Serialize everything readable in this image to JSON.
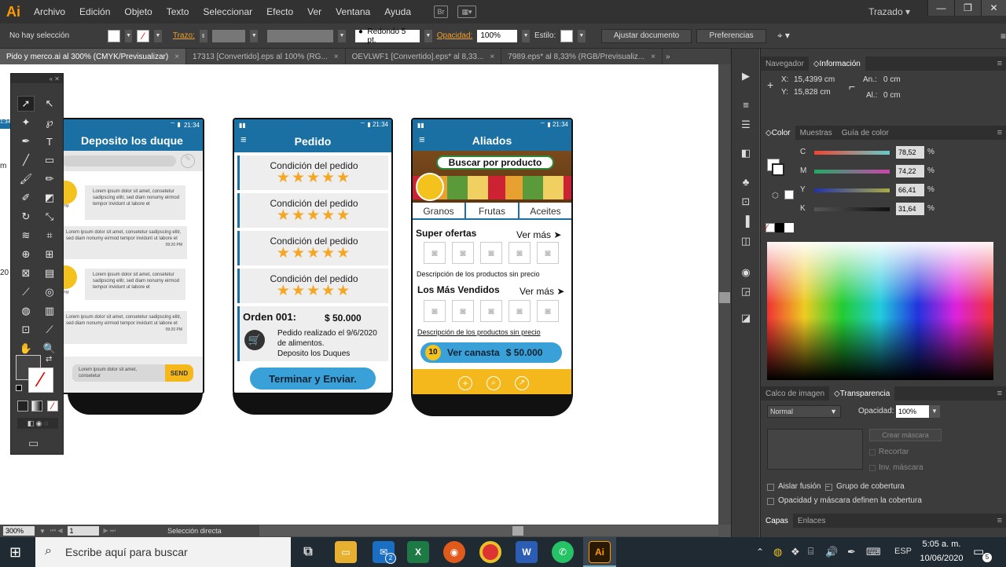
{
  "app": {
    "logo": "Ai",
    "menu": [
      "Archivo",
      "Edición",
      "Objeto",
      "Texto",
      "Seleccionar",
      "Efecto",
      "Ver",
      "Ventana",
      "Ayuda"
    ],
    "bridge_icon": "Br",
    "workspace": "Trazado",
    "window_controls": [
      "—",
      "❐",
      "✕"
    ]
  },
  "controlbar": {
    "selection": "No hay selección",
    "stroke_label": "Trazo:",
    "brush": "Redondo 5 pt.",
    "opacity_label": "Opacidad:",
    "opacity_value": "100%",
    "style_label": "Estilo:",
    "doc_setup_button": "Ajustar documento",
    "prefs_button": "Preferencias"
  },
  "tabs": [
    {
      "label": "Pido y merco.ai al 300% (CMYK/Previsualizar)",
      "active": true
    },
    {
      "label": "17313 [Convertido].eps al 100% (RG...",
      "active": false
    },
    {
      "label": "OEVLWF1 [Convertido].eps* al 8,33...",
      "active": false
    },
    {
      "label": "7989.eps* al 8,33% (RGB/Previsualiz...",
      "active": false
    }
  ],
  "statusbar": {
    "zoom": "300%",
    "artboard": "1",
    "tool_name": "Selección directa"
  },
  "mockups": {
    "chat": {
      "time": "21:34",
      "time_partial": "1:34",
      "title": "Deposito los duque",
      "lorem_short": "Lorem ipsum dolor sit amet, consetetur sadipscing elitr, sed diam nonumy eirmod tempor invidunt ut labore et",
      "lorem_long": "Lorem ipsum dolor sit amet, consetetur sadipscing elitr, sed diam nonumy eirmod tempor invidunt ut labore et",
      "msg_time": "09:20 PM",
      "time_pm": "PM",
      "input_text": "Lorem ipsum dolor sit amet, consetetur",
      "send": "SEND"
    },
    "pedido": {
      "time": "21:34",
      "title": "Pedido",
      "condition": "Condición del pedido",
      "stars": "★★★★★",
      "order_label": "Orden 001:",
      "order_price": "$ 50.000",
      "order_desc_1": "Pedido realizado el 9/6/2020",
      "order_desc_2": "de  alimentos.",
      "order_desc_3": "Deposito los Duques",
      "button": "Terminar y Enviar."
    },
    "aliados": {
      "time": "21:34",
      "title": "Aliados",
      "search_banner": "Buscar por producto",
      "categories": [
        "Granos",
        "Frutas",
        "Aceites"
      ],
      "offers_title": "Super ofertas",
      "see_more": "Ver más",
      "products_desc": "Descripción de los productos sin precio",
      "best_title": "Los Más Vendidos",
      "cart_count": "10",
      "cart_label": "Ver canasta",
      "cart_price": "$ 50.000"
    }
  },
  "canvas_left_labels": [
    "m",
    "20",
    "1:34"
  ],
  "right_panel": {
    "info_tabs": [
      "Navegador",
      "Información"
    ],
    "x_label": "X:",
    "x_value": "15,4399 cm",
    "y_label": "Y:",
    "y_value": "15,828 cm",
    "w_label": "An.:",
    "w_value": "0 cm",
    "h_label": "Al.:",
    "h_value": "0 cm",
    "color_tabs": [
      "Color",
      "Muestras",
      "Guía de color"
    ],
    "cmyk": [
      {
        "label": "C",
        "value": "78,52",
        "color": "#c8302a"
      },
      {
        "label": "M",
        "value": "74,22",
        "color": "#2f9a42"
      },
      {
        "label": "Y",
        "value": "66,41",
        "color": "#2b3aa8"
      },
      {
        "label": "K",
        "value": "31,64",
        "color": "#222222"
      }
    ],
    "percent": "%",
    "transp_tabs": [
      "Calco de imagen",
      "Transparencia"
    ],
    "blend_mode": "Normal",
    "opacity_label": "Opacidad:",
    "opacity_value": "100%",
    "make_mask": "Crear máscara",
    "clip": "Recortar",
    "invert_mask": "Inv. máscara",
    "isolate": "Aislar fusión",
    "knockout": "Grupo de cobertura",
    "opacity_mask": "Opacidad y máscara definen la cobertura",
    "layer_tabs": [
      "Capas",
      "Enlaces"
    ]
  },
  "taskbar": {
    "search_placeholder": "Escribe aquí para buscar",
    "mail_badge": "2",
    "lang": "ESP",
    "time": "5:05 a. m.",
    "date": "10/06/2020",
    "notif": "5"
  }
}
